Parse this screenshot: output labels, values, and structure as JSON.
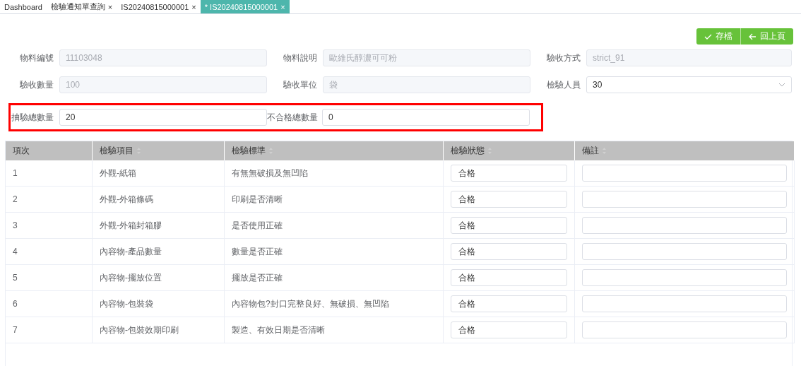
{
  "tabs": [
    {
      "label": "Dashboard",
      "selected": false
    },
    {
      "label": "檢驗通知單查詢",
      "close": "×",
      "selected": false
    },
    {
      "label": "IS20240815000001",
      "close": "×",
      "selected": false
    },
    {
      "label": "* IS20240815000001",
      "close": "×",
      "selected": true
    }
  ],
  "toolbar": [
    {
      "kind": "save",
      "label": "存檔"
    },
    {
      "kind": "back",
      "label": "回上頁"
    }
  ],
  "form_rows": [
    {
      "highlighted": false,
      "fields": [
        {
          "label": "物料編號",
          "value": "11103048",
          "kind": "readonly"
        },
        {
          "label": "物料說明",
          "value": "歐維氏醇濃可可粉",
          "kind": "readonly"
        },
        {
          "label": "驗收方式",
          "value": "strict_91",
          "kind": "readonly"
        }
      ]
    },
    {
      "highlighted": false,
      "fields": [
        {
          "label": "驗收數量",
          "value": "100",
          "kind": "readonly"
        },
        {
          "label": "驗收單位",
          "value": "袋",
          "kind": "readonly"
        },
        {
          "label": "檢驗人員",
          "value": "30",
          "kind": "select"
        }
      ]
    },
    {
      "highlighted": true,
      "fields": [
        {
          "label": "抽驗總數量",
          "value": "20",
          "kind": "input"
        },
        {
          "label": "不合格總數量",
          "value": "0",
          "kind": "input"
        }
      ]
    }
  ],
  "table": {
    "columns": [
      {
        "label": "項次",
        "sortable": false
      },
      {
        "label": "檢驗項目",
        "sortable": true
      },
      {
        "label": "檢驗標準",
        "sortable": true
      },
      {
        "label": "檢驗狀態",
        "sortable": true
      },
      {
        "label": "備註",
        "sortable": true
      }
    ],
    "rows": [
      {
        "no": "1",
        "item": "外觀-紙箱",
        "standard": "有無無破損及無凹陷",
        "status": "合格"
      },
      {
        "no": "2",
        "item": "外觀-外箱條碼",
        "standard": "印刷是否清晰",
        "status": "合格"
      },
      {
        "no": "3",
        "item": "外觀-外箱封箱膠",
        "standard": "是否使用正確",
        "status": "合格"
      },
      {
        "no": "4",
        "item": "內容物-產品數量",
        "standard": "數量是否正確",
        "status": "合格"
      },
      {
        "no": "5",
        "item": "內容物-擺放位置",
        "standard": "擺放是否正確",
        "status": "合格"
      },
      {
        "no": "6",
        "item": "內容物-包裝袋",
        "standard": "內容物包?封口完整良好、無破損、無凹陷",
        "status": "合格"
      },
      {
        "no": "7",
        "item": "內容物-包裝效期印刷",
        "standard": "製造、有效日期是否清晰",
        "status": "合格"
      }
    ]
  }
}
